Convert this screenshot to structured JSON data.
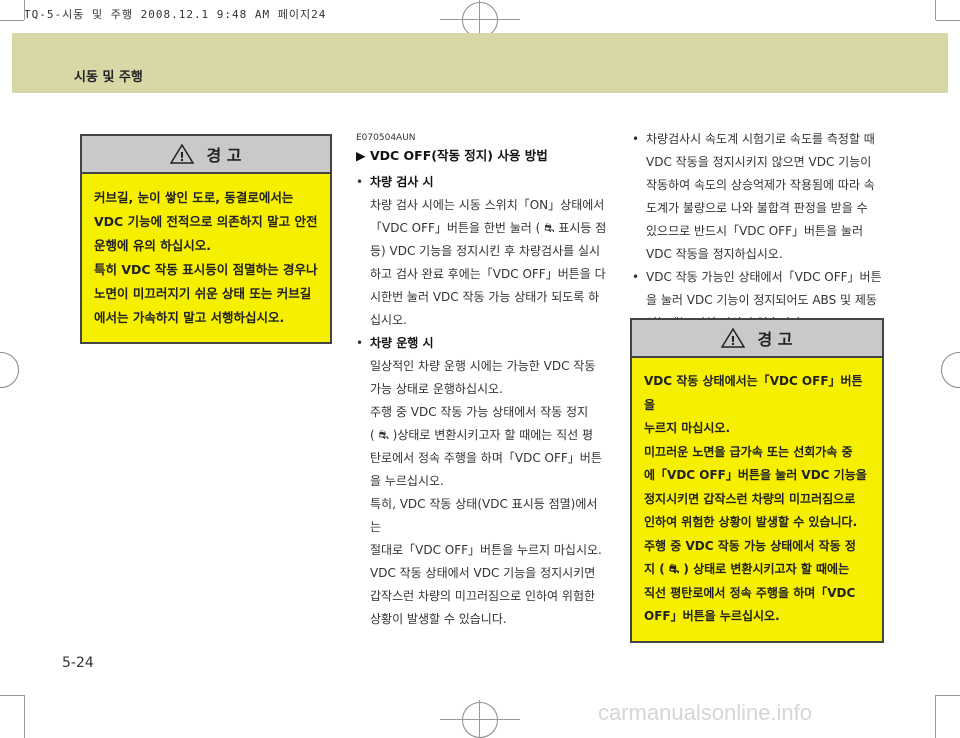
{
  "print_header": "TQ-5-시동 및 주행  2008.12.1 9:48 AM 페이지24",
  "section_title": "시동 및 주행",
  "page_number": "5-24",
  "watermark": "carmanualsonline.info",
  "warning_left": {
    "title": "경  고",
    "lines": [
      "커브길, 눈이 쌓인 도로, 동결로에서는",
      "VDC 기능에 전적으로 의존하지 말고 안전",
      "운행에 유의 하십시오.",
      "특히 VDC 작동 표시등이 점멸하는 경우나",
      "노면이 미끄러지기 쉬운 상태 또는 커브길",
      "에서는 가속하지 말고 서행하십시오."
    ]
  },
  "middle": {
    "code": "E070504AUN",
    "heading": "▶ VDC OFF(작동 정지) 사용 방법",
    "items": [
      {
        "title": "차량 검사 시",
        "lines": [
          "차량 검사 시에는 시동 스위치「ON」상태에서",
          "「VDC OFF」버튼을 한번 눌러 ( ⛐ 표시등 점",
          "등) VDC 기능을 정지시킨 후 차량검사를 실시",
          "하고 검사 완료 후에는「VDC OFF」버튼을 다",
          "시한번 눌러 VDC 작동 가능 상태가 되도록 하",
          "십시오."
        ]
      },
      {
        "title": "차량 운행 시",
        "lines": [
          "일상적인 차량 운행 시에는 가능한 VDC 작동",
          "가능 상태로 운행하십시오.",
          "주행 중 VDC 작동 가능 상태에서 작동 정지",
          "( ⛐ )상태로 변환시키고자 할 때에는 직선 평",
          "탄로에서 정속 주행을 하며「VDC OFF」버튼",
          "을 누르십시오.",
          "특히, VDC 작동 상태(VDC 표시등 점멸)에서는",
          "절대로「VDC OFF」버튼을 누르지 마십시오.",
          "VDC 작동 상태에서 VDC 기능을 정지시키면",
          "갑작스런 차량의 미끄러짐으로 인하여 위험한",
          "상황이 발생할 수 있습니다."
        ]
      }
    ]
  },
  "right": {
    "bullets": [
      {
        "lines": [
          "차량검사시 속도계 시험기로 속도를 측정할 때",
          "VDC 작동을 정지시키지 않으면 VDC 기능이",
          "작동하여 속도의 상승억제가 작용됨에 따라 속",
          "도계가 불량으로 나와 불합격 판정을 받을 수",
          "있으므로 반드시「VDC OFF」버튼을 눌러",
          "VDC 작동을 정지하십시오."
        ]
      },
      {
        "lines": [
          "VDC 작동 가능인 상태에서「VDC OFF」버튼",
          "을 눌러 VDC 기능이 정지되어도 ABS 및 제동",
          "성능에는 전혀 이상이 없습니다."
        ]
      }
    ]
  },
  "warning_right": {
    "title": "경  고",
    "lines": [
      "VDC 작동 상태에서는「VDC OFF」버튼을",
      "누르지 마십시오.",
      "미끄러운 노면을 급가속 또는 선회가속 중",
      "에「VDC OFF」버튼을 눌러 VDC 기능을",
      "정지시키면 갑작스런 차량의 미끄러짐으로",
      "인하여 위험한 상황이 발생할 수 있습니다.",
      "주행 중 VDC 작동 가능 상태에서 작동 정",
      "지 ( ⛐ ) 상태로 변환시키고자 할 때에는",
      "직선 평탄로에서 정속 주행을 하며「VDC",
      "OFF」버튼을 누르십시오."
    ]
  }
}
